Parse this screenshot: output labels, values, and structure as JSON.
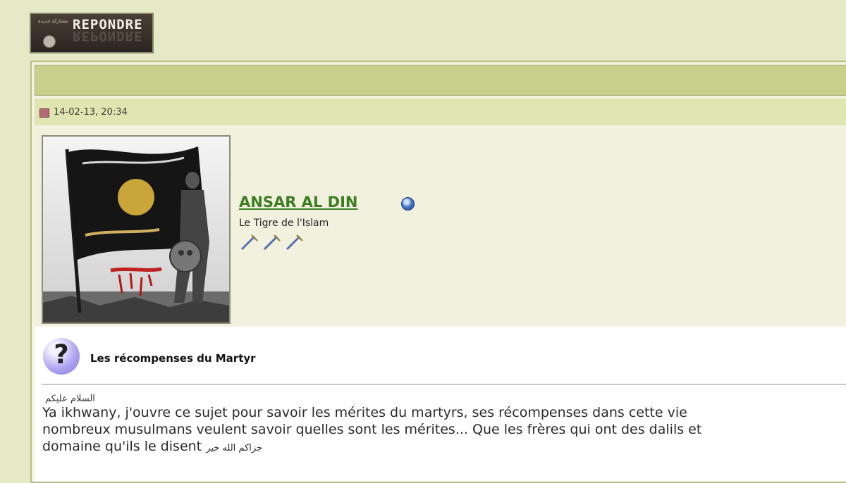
{
  "reply_button": {
    "label": "REPONDRE",
    "small_text": "مشاركة جديدة"
  },
  "post": {
    "date": "14-02-13, 20:34",
    "username": "ANSAR AL DIN",
    "user_title": "Le Tigre de l'Islam",
    "title": "Les récompenses du Martyr",
    "greeting": "السلام عليكم",
    "body_lines": [
      "Ya ikhwany, j'ouvre ce sujet pour savoir les mérites du martyrs, ses récompenses dans cette vie",
      "nombreux musulmans veulent savoir quelles sont les mérites... Que les frères qui ont des dalils et",
      "domaine qu'ils le disent"
    ],
    "closing_arabic": "جزاكم الله خير"
  },
  "colors": {
    "page_bg": "#e6e9c6",
    "header_bar": "#c9d08c",
    "meta_bar": "#e0e6b2",
    "username": "#3e7d23"
  },
  "icons": [
    "reply-globe-icon",
    "post-icon",
    "online-status-icon",
    "rank-icon",
    "question-icon"
  ]
}
